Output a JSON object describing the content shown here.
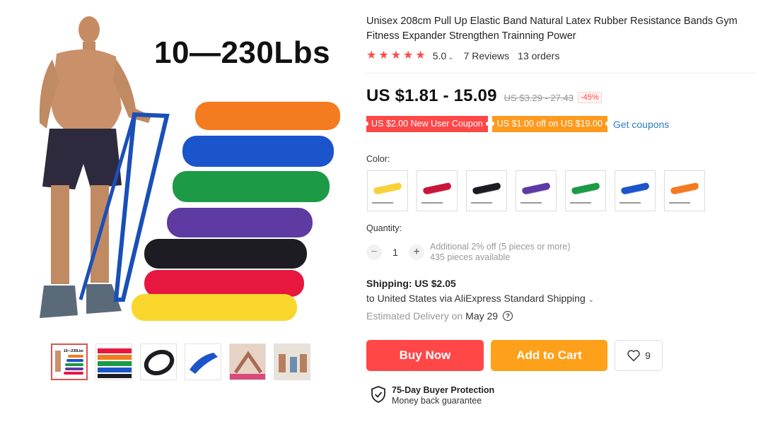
{
  "product": {
    "title": "Unisex 208cm Pull Up Elastic Band Natural Latex Rubber Resistance Bands Gym Fitness Expander Strengthen Trainning Power",
    "image_headline": "10—230Lbs",
    "rating": "5.0",
    "reviews": "7 Reviews",
    "orders": "13 orders",
    "price": "US $1.81 - 15.09",
    "original_price": "US $3.29 - 27.43",
    "discount": "-45%",
    "coupons": [
      {
        "label": "US $2.00 New User Coupon"
      },
      {
        "label": "US $1.00 off on US $19.00"
      }
    ],
    "get_coupons": "Get coupons",
    "color_label": "Color:",
    "colors": [
      {
        "name": "yellow-band",
        "hex": "#f6d23a"
      },
      {
        "name": "red-band",
        "hex": "#c8163b"
      },
      {
        "name": "black-band",
        "hex": "#1c1c22"
      },
      {
        "name": "purple-band",
        "hex": "#5e3aa3"
      },
      {
        "name": "green-band",
        "hex": "#1c9a45"
      },
      {
        "name": "blue-band",
        "hex": "#1a55cc"
      },
      {
        "name": "orange-band",
        "hex": "#f47b20"
      }
    ],
    "quantity_label": "Quantity:",
    "quantity": "1",
    "quantity_note": "Additional 2% off (5 pieces or more)",
    "available": "435 pieces available",
    "shipping_title": "Shipping: US $2.05",
    "shipping_route": "to United States via AliExpress Standard Shipping",
    "delivery_label": "Estimated Delivery on",
    "delivery_date": "May 29",
    "buy_now": "Buy Now",
    "add_to_cart": "Add to Cart",
    "wishlist_count": "9",
    "protection_title": "75-Day Buyer Protection",
    "protection_sub": "Money back guarantee"
  },
  "colors": {
    "accent_red": "#ff4747",
    "accent_orange": "#ffa01a",
    "link_blue": "#2f7cc9"
  }
}
